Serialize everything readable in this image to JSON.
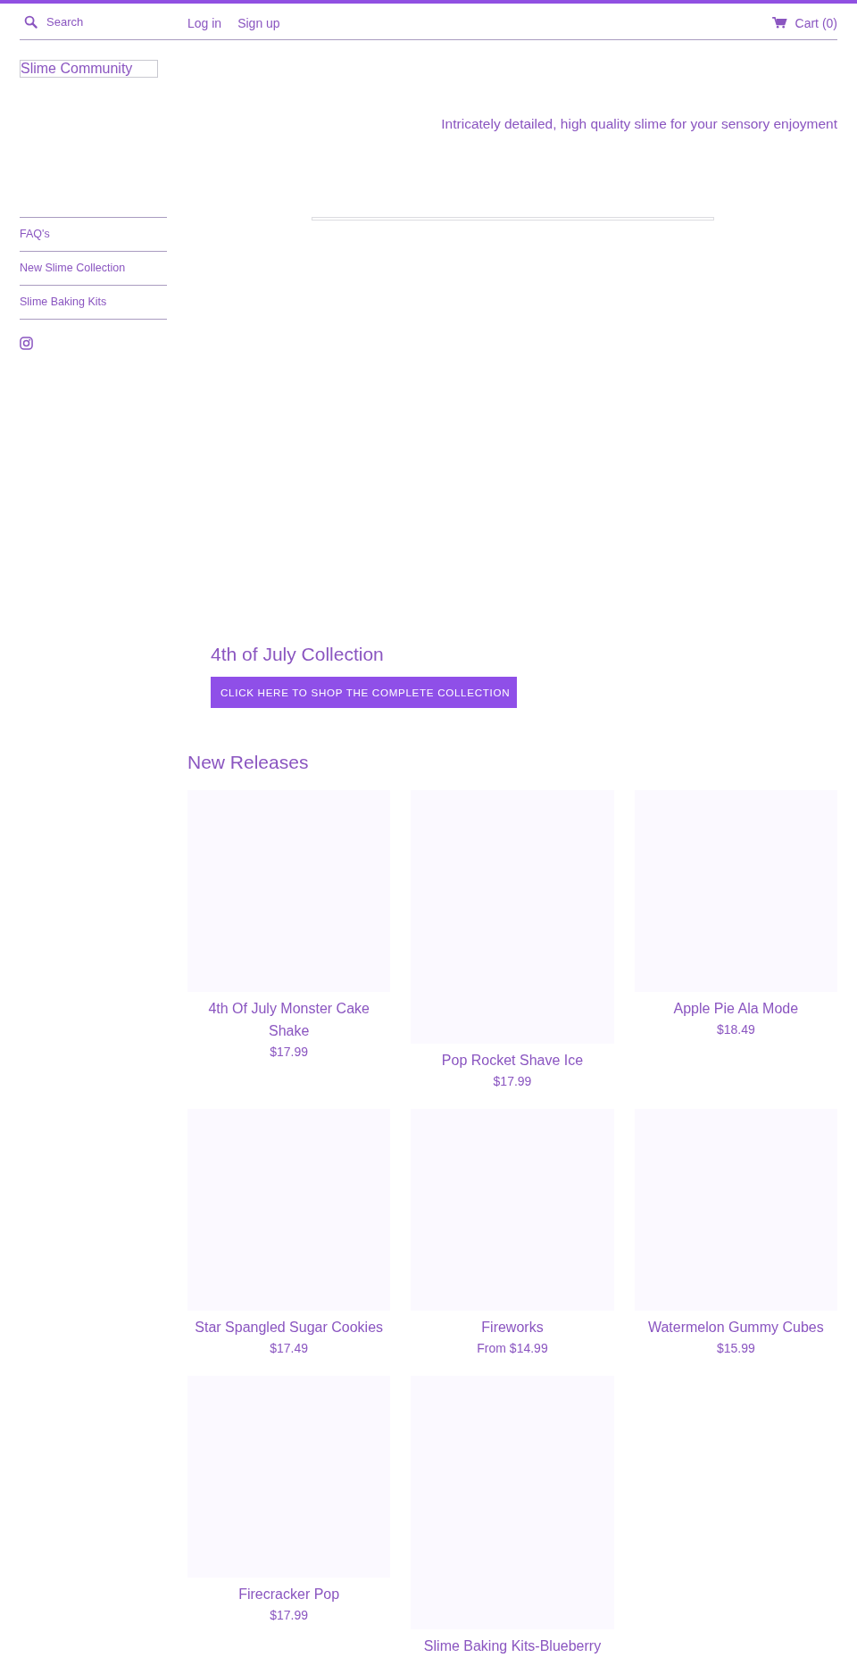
{
  "header": {
    "search": {
      "placeholder": "Search"
    },
    "account_links": [
      "Log in",
      "Sign up"
    ],
    "cart": "Cart (0)"
  },
  "logo": "Slime Community",
  "tagline": "Intricately detailed, high quality slime for your sensory enjoyment",
  "sidebar": {
    "items": [
      "FAQ's",
      "New Slime Collection",
      "Slime Baking Kits"
    ]
  },
  "featured": {
    "title": "4th of July Collection",
    "button": "CLICK HERE TO SHOP THE COMPLETE COLLECTION"
  },
  "new_releases": {
    "title": "New Releases",
    "products": [
      {
        "kind": "square",
        "name": "4th Of July Monster Cake Shake",
        "price": "$17.99"
      },
      {
        "kind": "tall",
        "name": "Pop Rocket Shave Ice",
        "price": "$17.99"
      },
      {
        "kind": "square",
        "name": "Apple Pie Ala Mode",
        "price": "$18.49"
      },
      {
        "kind": "square",
        "name": "Star Spangled Sugar Cookies",
        "price": "$17.49"
      },
      {
        "kind": "square",
        "name": "Fireworks",
        "price": "From $14.99"
      },
      {
        "kind": "square",
        "name": "Watermelon Gummy Cubes",
        "price": "$15.99"
      },
      {
        "kind": "square",
        "name": "Firecracker Pop",
        "price": "$17.99"
      },
      {
        "kind": "tall",
        "name": "Slime Baking Kits-Blueberry"
      }
    ]
  }
}
